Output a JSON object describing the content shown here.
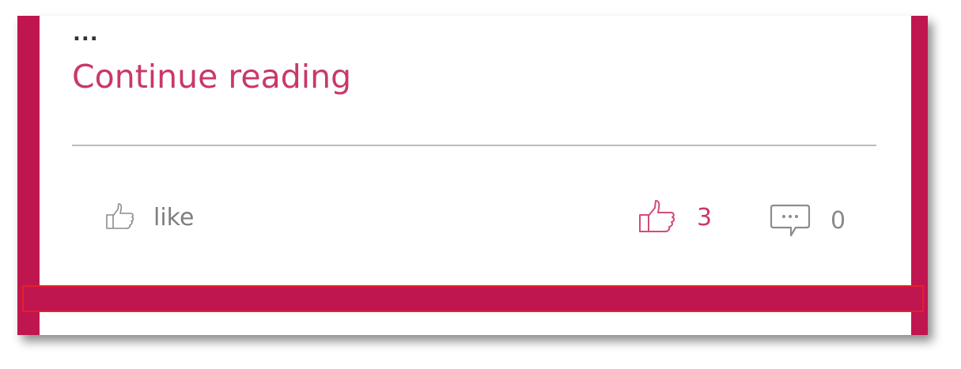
{
  "post": {
    "excerpt_end": "...",
    "continue_label": "Continue reading"
  },
  "actions": {
    "like_label": "like",
    "like_icon": "thumbs-up-outline-icon",
    "likes_icon": "thumbs-up-icon",
    "likes_count": "3",
    "comments_icon": "comment-bubble-icon",
    "comments_count": "0"
  },
  "colors": {
    "accent": "#c0164f",
    "link": "#c9386b",
    "muted": "#7f7f7f",
    "highlight_outline": "#e5202b"
  }
}
